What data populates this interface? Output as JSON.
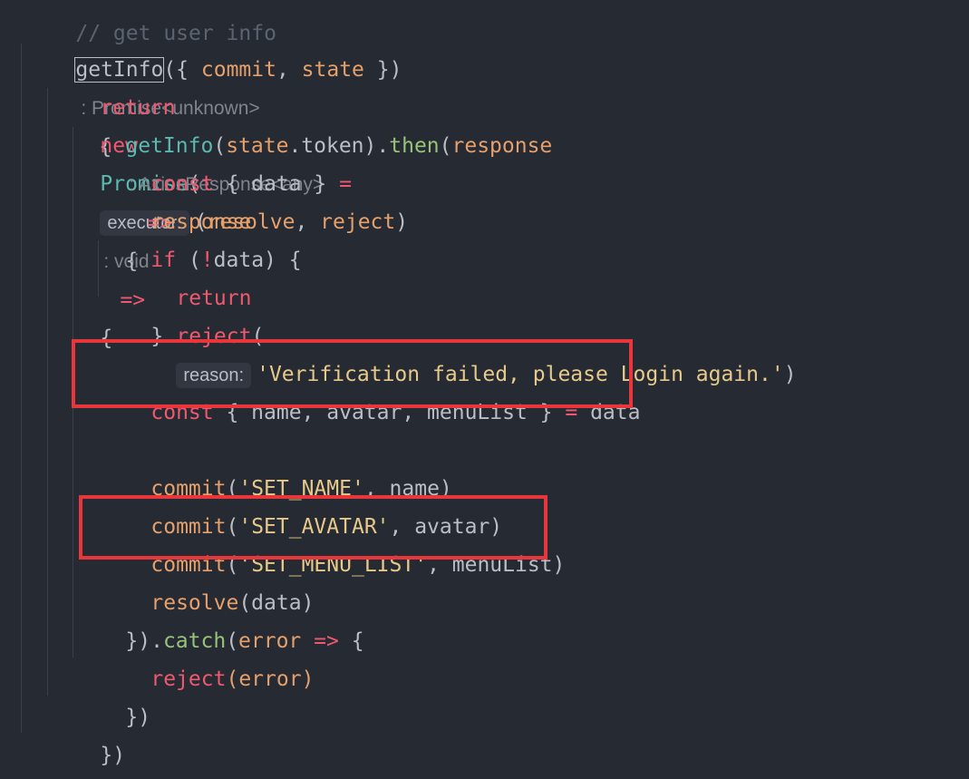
{
  "editor": {
    "comment_top": "// get user info",
    "lines": {
      "l1": {
        "fn": "getInfo",
        "rest_a": "({ ",
        "p1": "commit",
        "comma": ", ",
        "p2": "state",
        "rest_b": " })",
        "hint": ": Promise<unknown>",
        "brace": "{"
      },
      "l2": {
        "kw_return": "return",
        "kw_new": "new",
        "cls": "Promise",
        "paren": "(",
        "pill": "executor:",
        "open": "(",
        "p1": "resolve",
        "comma": ", ",
        "p2": "reject",
        "close": ")",
        "hint": ": void",
        "arrow": "=>",
        "brace": "{"
      },
      "l3": {
        "fn": "getInfo",
        "open": "(",
        "obj": "state",
        "dot": ".",
        "prop": "token",
        "close": ").",
        "then": "then",
        "open2": "(",
        "p1": "response",
        "hint": ": AxiosResponse<any>",
        "arrow": "=>",
        "brace": "{"
      },
      "l4": {
        "kw": "const",
        "mid": " { data } ",
        "eq": "=",
        "val": "response"
      },
      "l6": {
        "kw": "if",
        "mid": " (",
        "bang": "!",
        "rest": "data) {"
      },
      "l7": {
        "kw": "return",
        "fn": "reject",
        "open": "(",
        "pill": "reason:",
        "str": "'Verification failed, please Login again.'",
        "close": ")"
      },
      "l8": {
        "text": "}"
      },
      "l10": {
        "kw": "const",
        "mid": " { name, avatar, menuList } ",
        "eq": "=",
        "val": " data"
      },
      "l12": {
        "fn": "commit",
        "open": "(",
        "str": "'SET_NAME'",
        "rest": ", name)"
      },
      "l13": {
        "fn": "commit",
        "open": "(",
        "str": "'SET_AVATAR'",
        "rest": ", avatar)"
      },
      "l14": {
        "fn": "commit",
        "open": "(",
        "str": "'SET_MENU_LIST'",
        "rest": ", menuList)"
      },
      "l15": {
        "fn": "resolve",
        "rest": "(data)"
      },
      "l16": {
        "a": "}).",
        "catch": "catch",
        "open": "(",
        "p": "error",
        "arrow": " =>",
        "brace": " {"
      },
      "l17": {
        "fn": "reject",
        "rest": "(error)"
      },
      "l18": {
        "text": "})"
      },
      "l19": {
        "text": "})"
      },
      "l20": {
        "text": "},"
      }
    }
  }
}
